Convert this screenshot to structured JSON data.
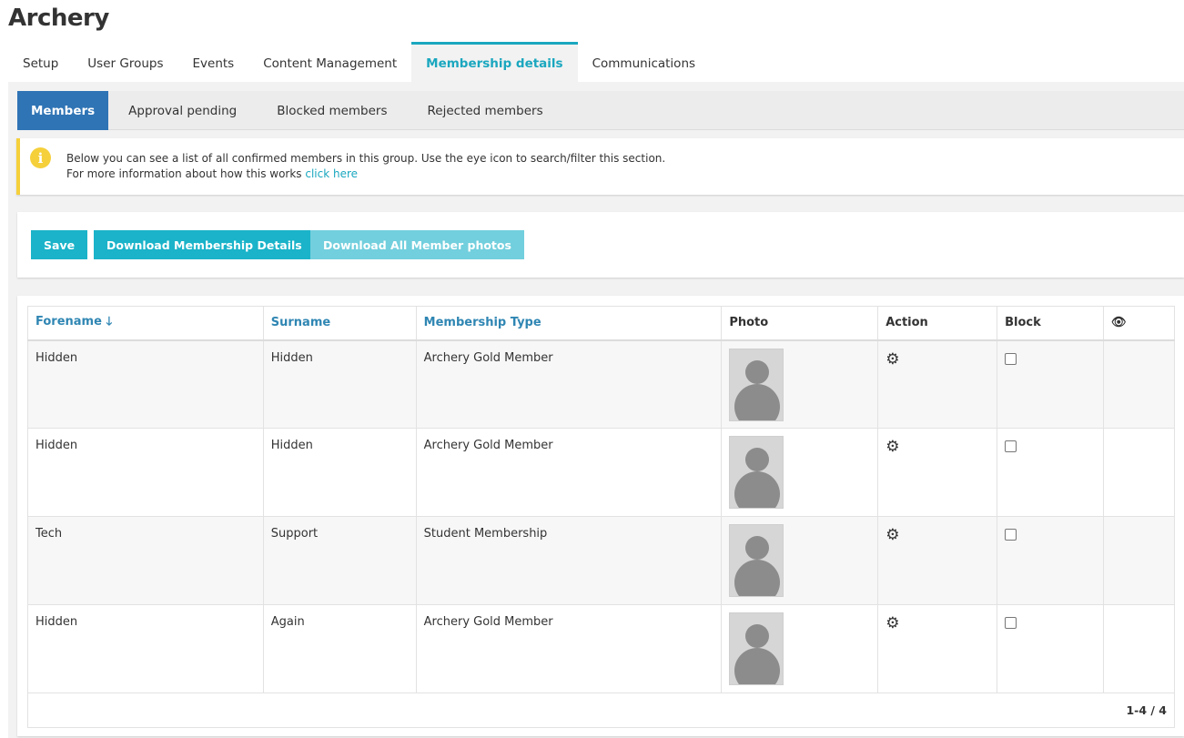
{
  "page": {
    "title": "Archery"
  },
  "main_tabs": [
    {
      "label": "Setup",
      "active": false
    },
    {
      "label": "User Groups",
      "active": false
    },
    {
      "label": "Events",
      "active": false
    },
    {
      "label": "Content Management",
      "active": false
    },
    {
      "label": "Membership details",
      "active": true
    },
    {
      "label": "Communications",
      "active": false
    }
  ],
  "sub_tabs": [
    {
      "label": "Members",
      "active": true
    },
    {
      "label": "Approval pending",
      "active": false
    },
    {
      "label": "Blocked members",
      "active": false
    },
    {
      "label": "Rejected members",
      "active": false
    }
  ],
  "info": {
    "icon": "info-icon",
    "line1": "Below you can see a list of all confirmed members in this group. Use the eye icon to search/filter this section.",
    "line2": "For more information about how this works ",
    "link": "click here",
    "accent_color": "#f5d03b"
  },
  "buttons": {
    "save": "Save",
    "download_details": "Download Membership Details",
    "download_photos": "Download All Member photos"
  },
  "table": {
    "headers": {
      "forename": "Forename",
      "surname": "Surname",
      "membership_type": "Membership Type",
      "photo": "Photo",
      "action": "Action",
      "block": "Block"
    },
    "sort_icon": "arrow-down-icon",
    "rows": [
      {
        "forename": "Hidden",
        "surname": "Hidden",
        "membership_type": "Archery Gold Member",
        "blocked": false
      },
      {
        "forename": "Hidden",
        "surname": "Hidden",
        "membership_type": "Archery Gold Member",
        "blocked": false
      },
      {
        "forename": "Tech",
        "surname": "Support",
        "membership_type": "Student Membership",
        "blocked": false
      },
      {
        "forename": "Hidden",
        "surname": "Again",
        "membership_type": "Archery Gold Member",
        "blocked": false
      }
    ],
    "pagination": "1-4 / 4"
  },
  "colors": {
    "accent": "#1aa7bf",
    "button": "#1ab3c9",
    "active_subtab": "#2f74b5",
    "link": "#2f86b3"
  }
}
